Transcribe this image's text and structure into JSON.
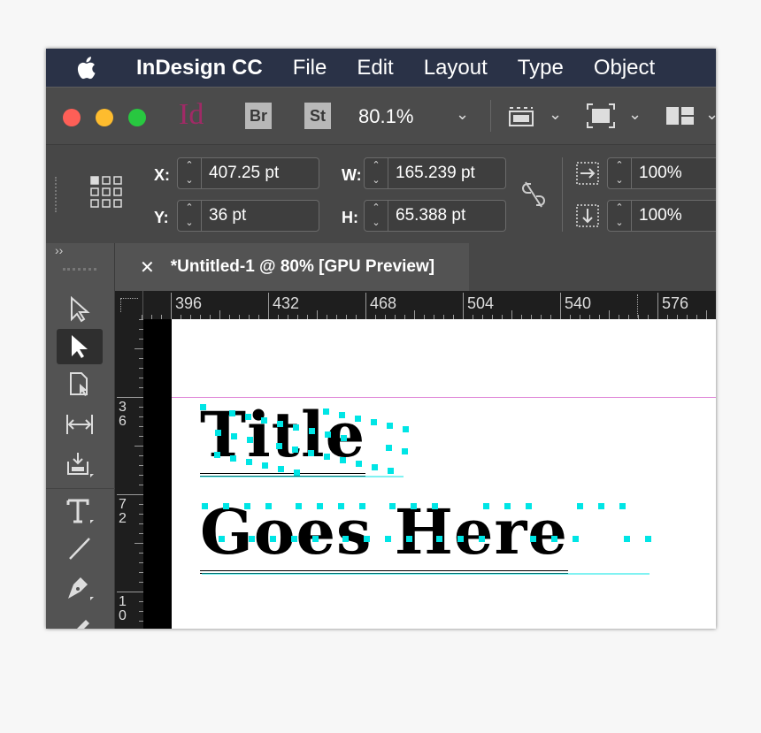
{
  "menubar": {
    "app_name": "InDesign CC",
    "items": [
      "File",
      "Edit",
      "Layout",
      "Type",
      "Object"
    ]
  },
  "appbar": {
    "logo": "Id",
    "bridge": "Br",
    "stock": "St",
    "zoom": "80.1%",
    "colors": {
      "close": "#fe5f57",
      "minimize": "#febc2e",
      "zoom": "#28c840",
      "logo": "#a02a66"
    }
  },
  "control": {
    "x_label": "X:",
    "x_value": "407.25 pt",
    "y_label": "Y:",
    "y_value": "36 pt",
    "w_label": "W:",
    "w_value": "165.239 pt",
    "h_label": "H:",
    "h_value": "65.388 pt",
    "scale_x": "100%",
    "scale_y": "100%"
  },
  "document": {
    "tab_title": "*Untitled-1 @ 80% [GPU Preview]",
    "ruler_top": [
      "396",
      "432",
      "468",
      "504",
      "540",
      "576"
    ],
    "ruler_left": [
      [
        "3",
        "6"
      ],
      [
        "7",
        "2"
      ],
      [
        "1",
        "0"
      ]
    ],
    "text_line1": "Title",
    "text_line2": "Goes Here",
    "outline_color": "#00e5e5",
    "guide_color": "#e08ad9"
  }
}
